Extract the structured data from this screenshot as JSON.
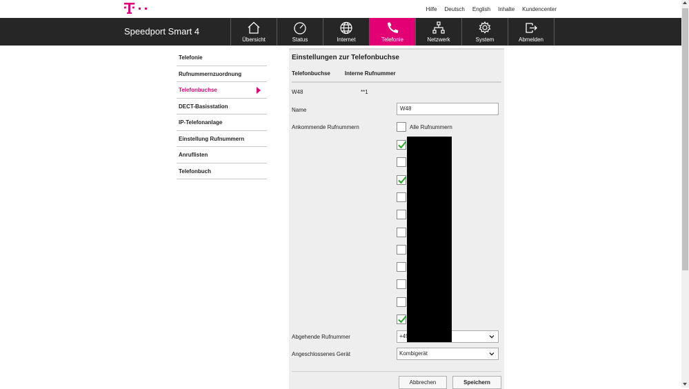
{
  "top_links": [
    "Hilfe",
    "Deutsch",
    "English",
    "Inhalte",
    "Kundencenter"
  ],
  "brand": "Speedport Smart 4",
  "colors": {
    "accent": "#e20074",
    "header_bg": "#262626",
    "check": "#2aa52a"
  },
  "nav": [
    {
      "label": "Übersicht",
      "icon": "home-icon"
    },
    {
      "label": "Status",
      "icon": "gauge-icon"
    },
    {
      "label": "Internet",
      "icon": "globe-icon"
    },
    {
      "label": "Telefonie",
      "icon": "phone-icon",
      "active": true
    },
    {
      "label": "Netzwerk",
      "icon": "network-icon"
    },
    {
      "label": "System",
      "icon": "gear-icon"
    },
    {
      "label": "Abmelden",
      "icon": "logout-icon"
    }
  ],
  "sidebar": [
    {
      "label": "Telefonie"
    },
    {
      "label": "Rufnummernzuordnung"
    },
    {
      "label": "Telefonbuchse",
      "active": true
    },
    {
      "label": "DECT-Basisstation"
    },
    {
      "label": "IP-Telefonanlage"
    },
    {
      "label": "Einstellung Rufnummern"
    },
    {
      "label": "Anruflisten"
    },
    {
      "label": "Telefonbuch"
    }
  ],
  "panel": {
    "title": "Einstellungen zur Telefonbuchse",
    "tabs": [
      "Telefonbuchse",
      "Interne Rufnummer"
    ],
    "device_id": "W48",
    "internal_number": "**1",
    "name_label": "Name",
    "name_value": "W48",
    "incoming_label": "Ankommende Rufnummern",
    "all_numbers_label": "Alle Rufnummern",
    "incoming_checks": [
      true,
      false,
      true,
      false,
      false,
      false,
      false,
      false,
      false,
      false,
      true
    ],
    "outgoing_label": "Abgehende Rufnummer",
    "outgoing_value": "+49",
    "device_label": "Angeschlossenes Gerät",
    "device_value": "Kombigerät",
    "cancel_label": "Abbrechen",
    "save_label": "Speichern"
  }
}
